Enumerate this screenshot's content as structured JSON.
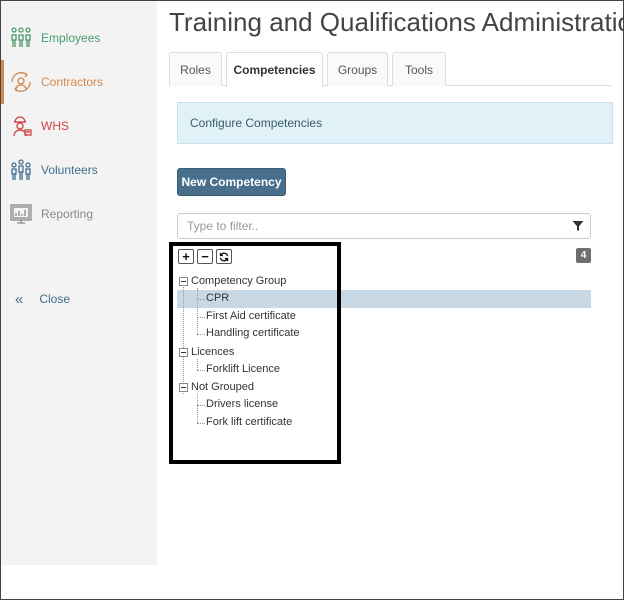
{
  "sidebar": {
    "items": [
      {
        "label": "Employees",
        "icon": "employees-icon",
        "color": "#4c9a6e"
      },
      {
        "label": "Contractors",
        "icon": "contractors-icon",
        "color": "#d08a4f"
      },
      {
        "label": "WHS",
        "icon": "whs-icon",
        "color": "#d04545"
      },
      {
        "label": "Volunteers",
        "icon": "volunteers-icon",
        "color": "#3f6e8c"
      },
      {
        "label": "Reporting",
        "icon": "reporting-icon",
        "color": "#8a8a8a"
      }
    ],
    "close_label": "Close",
    "close_icon": "«"
  },
  "page": {
    "title": "Training and Qualifications Administration"
  },
  "tabs": [
    {
      "label": "Roles"
    },
    {
      "label": "Competencies",
      "active": true
    },
    {
      "label": "Groups"
    },
    {
      "label": "Tools"
    }
  ],
  "info_box": {
    "text": "Configure Competencies"
  },
  "new_button": {
    "label": "New Competency"
  },
  "filter": {
    "placeholder": "Type to filter..",
    "value": ""
  },
  "count_badge": "4",
  "tree_controls": {
    "expand": "+",
    "collapse": "−",
    "refresh": "⟳"
  },
  "tree": {
    "groups": [
      {
        "label": "Competency Group",
        "children": [
          "CPR",
          "First Aid certificate",
          "Handling certificate"
        ]
      },
      {
        "label": "Licences",
        "children": [
          "Forklift Licence"
        ]
      },
      {
        "label": "Not Grouped",
        "children": [
          "Drivers license",
          "Fork lift certificate"
        ]
      }
    ],
    "selected": "CPR"
  },
  "colors": {
    "accent": "#476f8c",
    "info_bg": "#e0f1f7",
    "selection": "#c8d8e4"
  }
}
